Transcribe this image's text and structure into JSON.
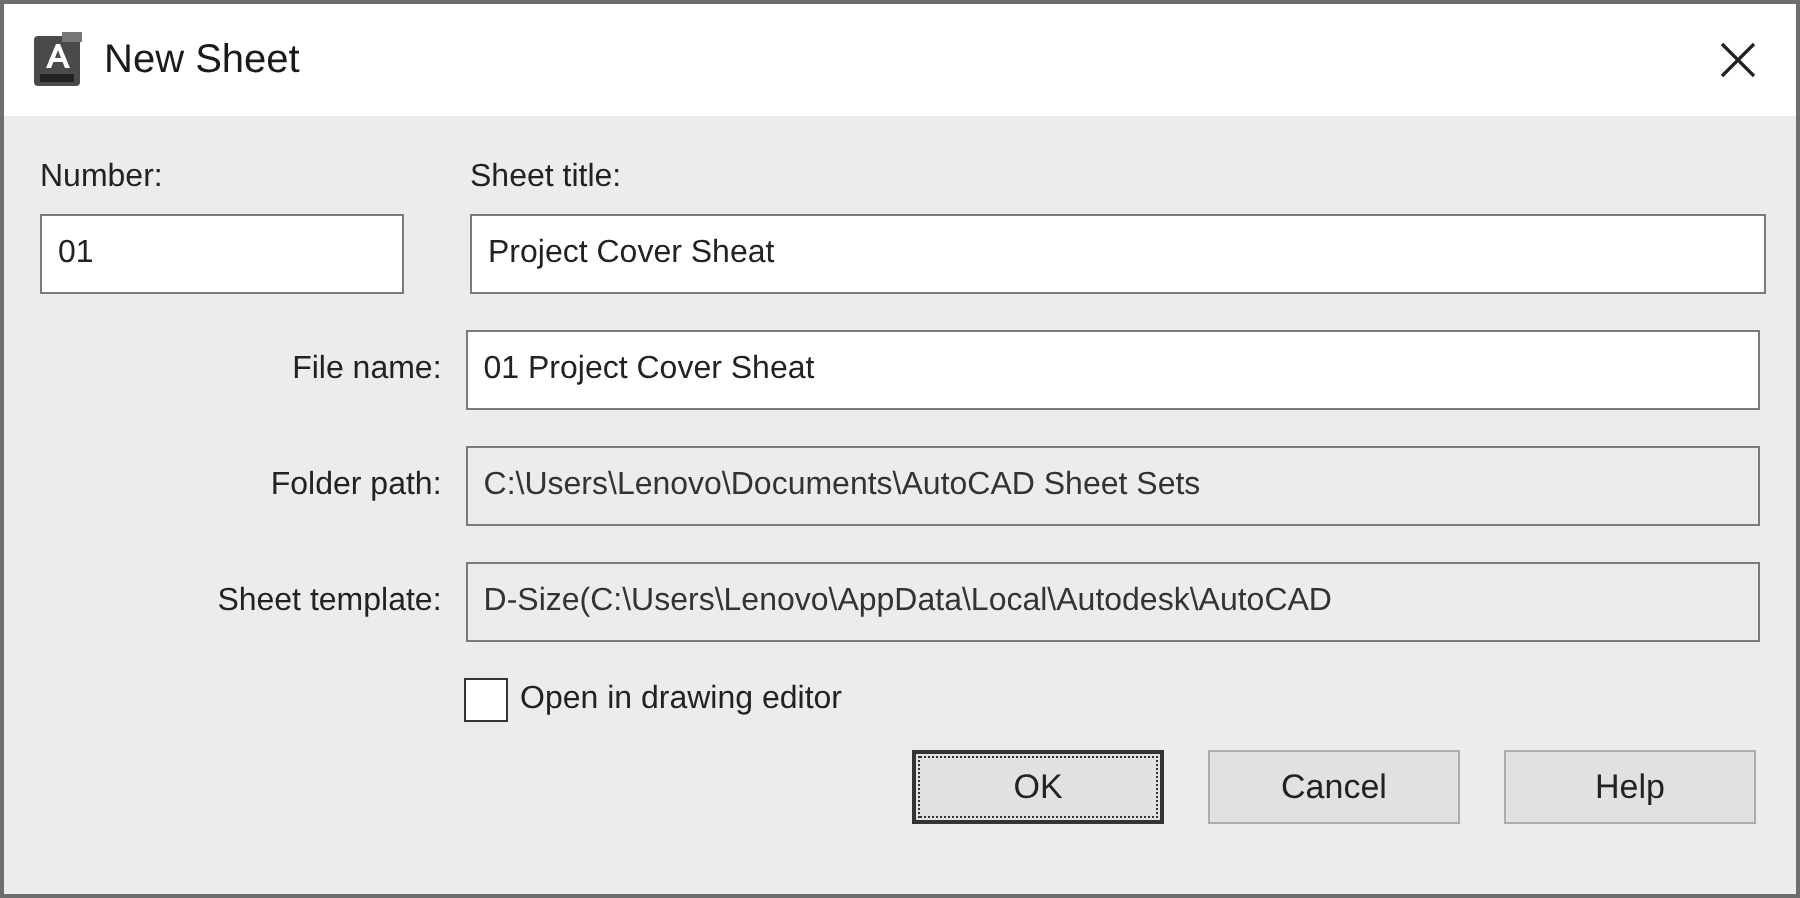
{
  "window": {
    "title": "New Sheet"
  },
  "number": {
    "label": "Number:",
    "value": "01",
    "disabled": false
  },
  "sheet_title": {
    "label": "Sheet title:",
    "value": "Project Cover Sheat",
    "disabled": false
  },
  "fields": [
    {
      "label": "File name:",
      "value": "01 Project Cover Sheat",
      "disabled": false
    },
    {
      "label": "Folder path:",
      "value": "C:\\Users\\Lenovo\\Documents\\AutoCAD Sheet Sets",
      "disabled": true
    },
    {
      "label": "Sheet template:",
      "value": "D-Size(C:\\Users\\Lenovo\\AppData\\Local\\Autodesk\\AutoCAD",
      "disabled": true
    }
  ],
  "open_in_editor": {
    "label": "Open in drawing editor",
    "checked": false
  },
  "buttons": [
    {
      "label": "OK",
      "default": true
    },
    {
      "label": "Cancel",
      "default": false
    },
    {
      "label": "Help",
      "default": false
    }
  ]
}
